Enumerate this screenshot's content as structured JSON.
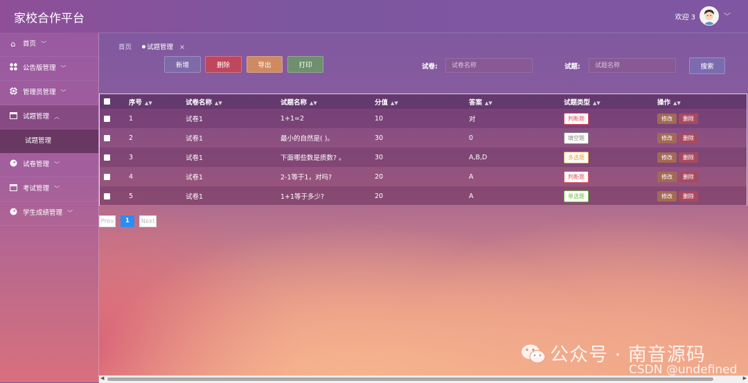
{
  "app": {
    "title": "家校合作平台"
  },
  "user": {
    "welcome": "欢迎 3"
  },
  "sidebar": {
    "items": [
      {
        "label": "首页",
        "icon": "home-icon",
        "chevron": "﹀"
      },
      {
        "label": "公告版管理",
        "icon": "grid-icon",
        "chevron": "﹀"
      },
      {
        "label": "管理员管理",
        "icon": "chip-icon",
        "chevron": "﹀"
      },
      {
        "label": "试题管理",
        "icon": "window-icon",
        "chevron": "︿"
      },
      {
        "label": "试卷管理",
        "icon": "gauge-icon",
        "chevron": "﹀"
      },
      {
        "label": "考试管理",
        "icon": "window-icon",
        "chevron": "﹀"
      },
      {
        "label": "学生成绩管理",
        "icon": "gauge-icon",
        "chevron": "﹀"
      }
    ],
    "sub_item": "试题管理"
  },
  "breadcrumb": {
    "home": "首页",
    "current": "试题管理",
    "close": "×"
  },
  "toolbar": {
    "add": "新增",
    "delete": "删除",
    "export": "导出",
    "print": "打印"
  },
  "search": {
    "paper_label": "试卷:",
    "paper_placeholder": "试卷名称",
    "question_label": "试题:",
    "question_placeholder": "试题名称",
    "button": "搜索"
  },
  "table": {
    "headers": [
      "序号",
      "试卷名称",
      "试题名称",
      "分值",
      "答案",
      "试题类型",
      "操作"
    ],
    "rows": [
      {
        "no": "1",
        "paper": "试卷1",
        "question": "1+1=2",
        "score": "10",
        "answer": "对",
        "type": "判断题",
        "type_color": "#e4505f"
      },
      {
        "no": "2",
        "paper": "试卷1",
        "question": "最小的自然是( )。",
        "score": "30",
        "answer": "0",
        "type": "填空题",
        "type_color": "#888888"
      },
      {
        "no": "3",
        "paper": "试卷1",
        "question": "下面哪些数是质数? 。",
        "score": "30",
        "answer": "A,B,D",
        "type": "多选题",
        "type_color": "#e6a23c"
      },
      {
        "no": "4",
        "paper": "试卷1",
        "question": "2-1等于1，对吗?",
        "score": "20",
        "answer": "A",
        "type": "判断题",
        "type_color": "#e4505f"
      },
      {
        "no": "5",
        "paper": "试卷1",
        "question": "1+1等于多少?",
        "score": "20",
        "answer": "A",
        "type": "单选题",
        "type_color": "#67c23a"
      }
    ],
    "edit_label": "修改",
    "delete_label": "删除"
  },
  "pagination": {
    "prev": "Prev",
    "page": "1",
    "next": "Next"
  },
  "watermark": {
    "wechat": "公众号 · 南音源码",
    "csdn": "CSDN @undefined"
  },
  "colors": {
    "btn_add": "#7e6aa8",
    "btn_delete": "#c0465e",
    "btn_export": "#cf8a62",
    "btn_print": "#6f8f6e",
    "btn_search": "#7d6bb0",
    "op_edit": "#a26a55",
    "op_delete": "#a84a5f"
  }
}
